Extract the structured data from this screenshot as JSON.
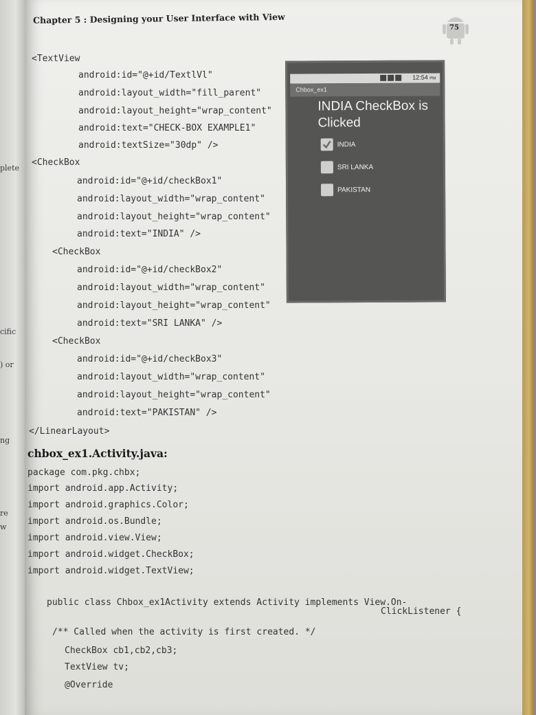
{
  "left_page": {
    "fragments": [
      "plete",
      "cific",
      ") or",
      "ng",
      "re",
      "w"
    ]
  },
  "header": {
    "chapter_title": "Chapter 5 : Designing your User Interface with View",
    "page_number": "75"
  },
  "xml_lines": [
    "<TextView",
    "android:id=\"@+id/TextlVl\"",
    "android:layout_width=\"fill_parent\"",
    "android:layout_height=\"wrap_content\"",
    "android:text=\"CHECK-BOX EXAMPLE1\"",
    "android:textSize=\"30dp\" />",
    "<CheckBox",
    "android:id=\"@+id/checkBox1\"",
    "android:layout_width=\"wrap_content\"",
    "android:layout_height=\"wrap_content\"",
    "android:text=\"INDIA\" />",
    "<CheckBox",
    "android:id=\"@+id/checkBox2\"",
    "android:layout_width=\"wrap_content\"",
    "android:layout_height=\"wrap_content\"",
    "android:text=\"SRI LANKA\" />",
    "<CheckBox",
    "android:id=\"@+id/checkBox3\"",
    "android:layout_width=\"wrap_content\"",
    "android:layout_height=\"wrap_content\"",
    "android:text=\"PAKISTAN\" />",
    "</LinearLayout>"
  ],
  "java_heading": "chbox_ex1.Activity.java:",
  "java_lines": [
    "package com.pkg.chbx;",
    "import android.app.Activity;",
    "import android.graphics.Color;",
    "import android.os.Bundle;",
    "import android.view.View;",
    "import android.widget.CheckBox;",
    "import android.widget.TextView;",
    "public class Chbox_ex1Activity extends Activity implements View.On-",
    "ClickListener {",
    "/** Called when the activity is first created. */",
    "CheckBox cb1,cb2,cb3;",
    "TextView tv;",
    "@Override"
  ],
  "phone": {
    "status_time": "12:54",
    "status_time_suffix": "PM",
    "app_title": "Chbox_ex1",
    "status_text": "INDIA CheckBox is Clicked",
    "checkboxes": [
      {
        "label": "INDIA",
        "checked": true
      },
      {
        "label": "SRI LANKA",
        "checked": false
      },
      {
        "label": "PAKISTAN",
        "checked": false
      }
    ]
  }
}
